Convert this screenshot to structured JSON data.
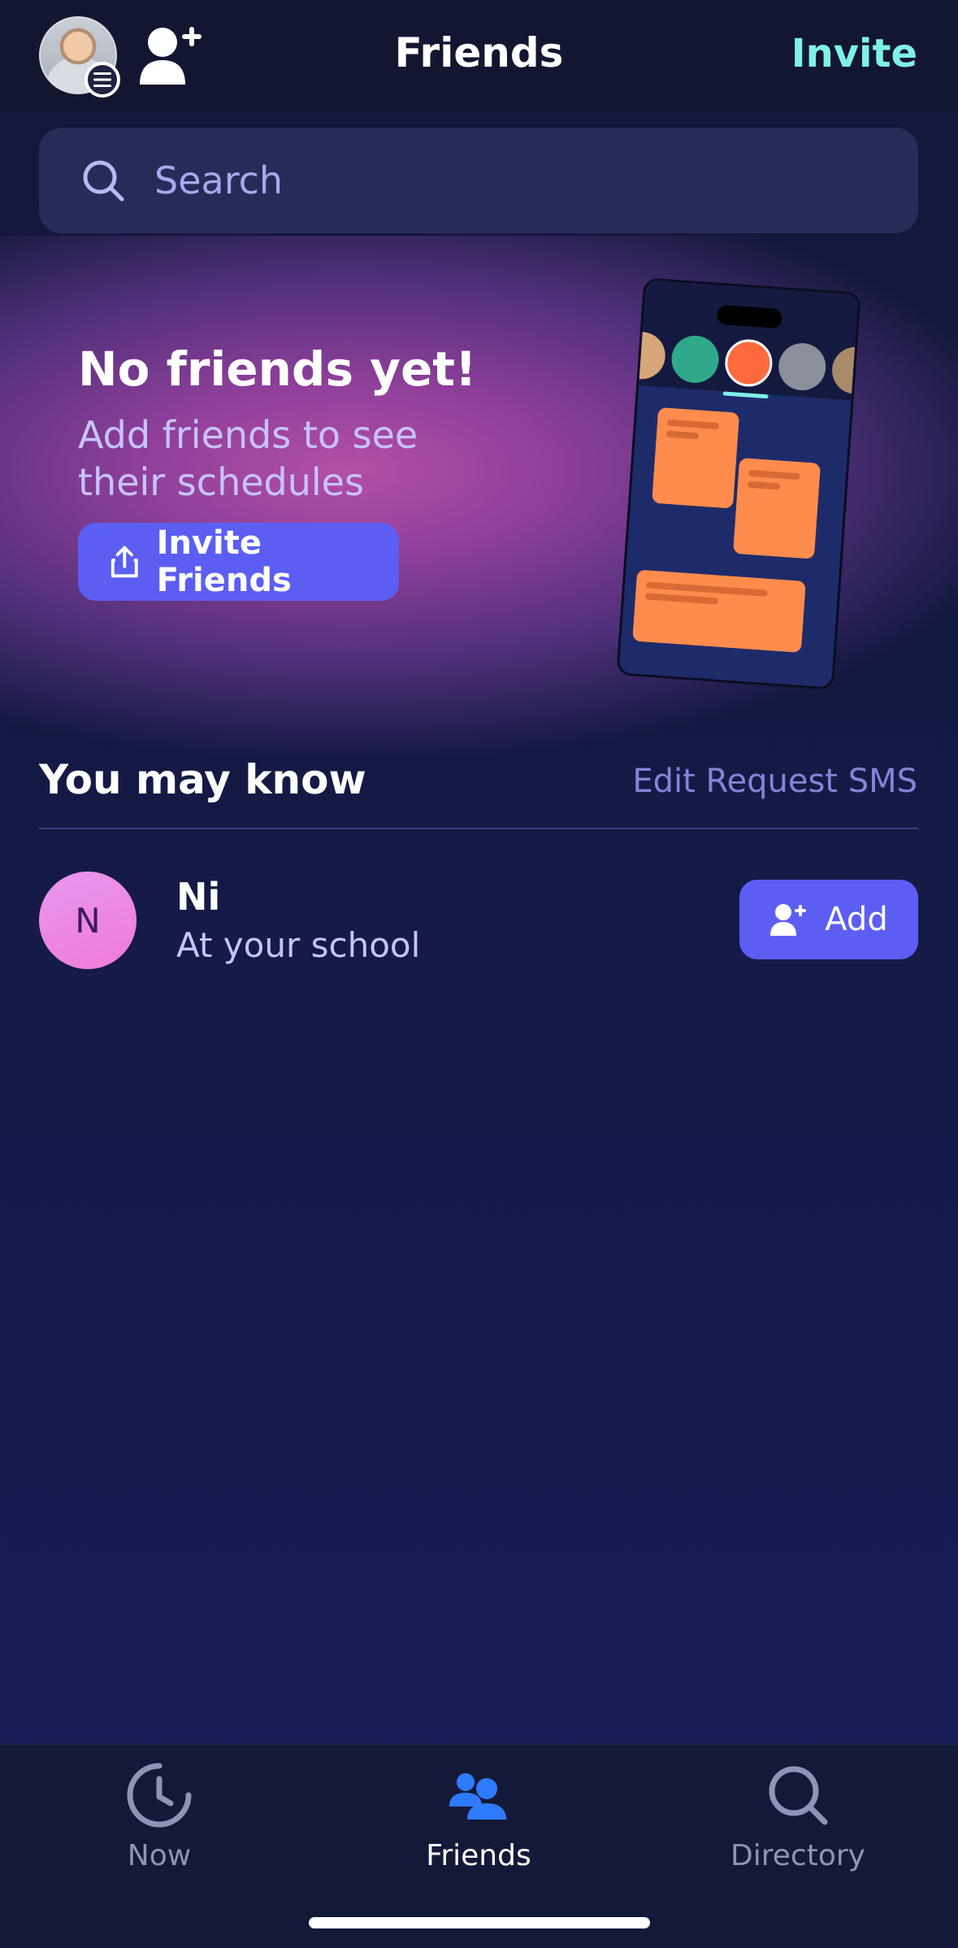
{
  "header": {
    "title": "Friends",
    "invite_label": "Invite"
  },
  "search": {
    "placeholder": "Search"
  },
  "empty_state": {
    "title": "No friends yet!",
    "subtitle": "Add friends to see their schedules",
    "button_label": "Invite Friends"
  },
  "suggestions": {
    "title": "You may know",
    "edit_label": "Edit Request SMS",
    "items": [
      {
        "initial": "N",
        "name": "Ni",
        "subtitle": "At your school",
        "button_label": "Add"
      }
    ]
  },
  "tabbar": {
    "tabs": [
      {
        "label": "Now",
        "icon": "clock-icon",
        "active": false
      },
      {
        "label": "Friends",
        "icon": "friends-icon",
        "active": true
      },
      {
        "label": "Directory",
        "icon": "search-icon",
        "active": false
      }
    ]
  },
  "colors": {
    "accent": "#5c5ef3",
    "invite_link": "#7ff0e8",
    "active_tab_icon": "#2f7bff",
    "inactive_tab": "#8f93b8"
  }
}
